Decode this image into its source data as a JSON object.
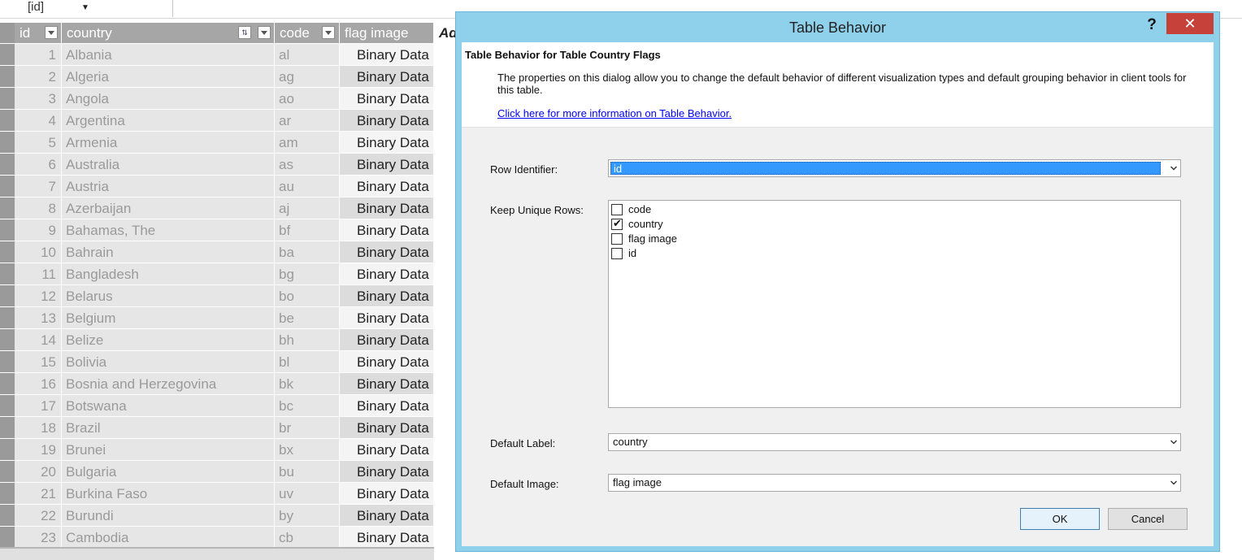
{
  "name_box": {
    "value": "[id]"
  },
  "grid": {
    "columns": [
      {
        "key": "id",
        "label": "id"
      },
      {
        "key": "country",
        "label": "country"
      },
      {
        "key": "code",
        "label": "code"
      },
      {
        "key": "flag",
        "label": "flag image"
      }
    ],
    "add_column_label": "Ad",
    "rows": [
      {
        "id": "1",
        "country": "Albania",
        "code": "al",
        "flag": "Binary Data"
      },
      {
        "id": "2",
        "country": "Algeria",
        "code": "ag",
        "flag": "Binary Data"
      },
      {
        "id": "3",
        "country": "Angola",
        "code": "ao",
        "flag": "Binary Data"
      },
      {
        "id": "4",
        "country": "Argentina",
        "code": "ar",
        "flag": "Binary Data"
      },
      {
        "id": "5",
        "country": "Armenia",
        "code": "am",
        "flag": "Binary Data"
      },
      {
        "id": "6",
        "country": "Australia",
        "code": "as",
        "flag": "Binary Data"
      },
      {
        "id": "7",
        "country": "Austria",
        "code": "au",
        "flag": "Binary Data"
      },
      {
        "id": "8",
        "country": "Azerbaijan",
        "code": "aj",
        "flag": "Binary Data"
      },
      {
        "id": "9",
        "country": "Bahamas, The",
        "code": "bf",
        "flag": "Binary Data"
      },
      {
        "id": "10",
        "country": "Bahrain",
        "code": "ba",
        "flag": "Binary Data"
      },
      {
        "id": "11",
        "country": "Bangladesh",
        "code": "bg",
        "flag": "Binary Data"
      },
      {
        "id": "12",
        "country": "Belarus",
        "code": "bo",
        "flag": "Binary Data"
      },
      {
        "id": "13",
        "country": "Belgium",
        "code": "be",
        "flag": "Binary Data"
      },
      {
        "id": "14",
        "country": "Belize",
        "code": "bh",
        "flag": "Binary Data"
      },
      {
        "id": "15",
        "country": "Bolivia",
        "code": "bl",
        "flag": "Binary Data"
      },
      {
        "id": "16",
        "country": "Bosnia and Herzegovina",
        "code": "bk",
        "flag": "Binary Data"
      },
      {
        "id": "17",
        "country": "Botswana",
        "code": "bc",
        "flag": "Binary Data"
      },
      {
        "id": "18",
        "country": "Brazil",
        "code": "br",
        "flag": "Binary Data"
      },
      {
        "id": "19",
        "country": "Brunei",
        "code": "bx",
        "flag": "Binary Data"
      },
      {
        "id": "20",
        "country": "Bulgaria",
        "code": "bu",
        "flag": "Binary Data"
      },
      {
        "id": "21",
        "country": "Burkina Faso",
        "code": "uv",
        "flag": "Binary Data"
      },
      {
        "id": "22",
        "country": "Burundi",
        "code": "by",
        "flag": "Binary Data"
      },
      {
        "id": "23",
        "country": "Cambodia",
        "code": "cb",
        "flag": "Binary Data"
      }
    ]
  },
  "dialog": {
    "title": "Table Behavior",
    "help_label": "?",
    "close_label": "✕",
    "heading": "Table Behavior for Table Country Flags",
    "description": "The properties on this dialog allow you to change the default behavior of different visualization types and default grouping behavior in client tools for this table.",
    "link_text": "Click here for more information on Table Behavior.",
    "row_identifier": {
      "label": "Row Identifier:",
      "value": "id"
    },
    "keep_unique_rows": {
      "label": "Keep Unique Rows:",
      "items": [
        {
          "label": "code",
          "checked": false
        },
        {
          "label": "country",
          "checked": true
        },
        {
          "label": "flag image",
          "checked": false
        },
        {
          "label": "id",
          "checked": false
        }
      ]
    },
    "default_label": {
      "label": "Default Label:",
      "value": "country"
    },
    "default_image": {
      "label": "Default Image:",
      "value": "flag image"
    },
    "ok_label": "OK",
    "cancel_label": "Cancel"
  }
}
